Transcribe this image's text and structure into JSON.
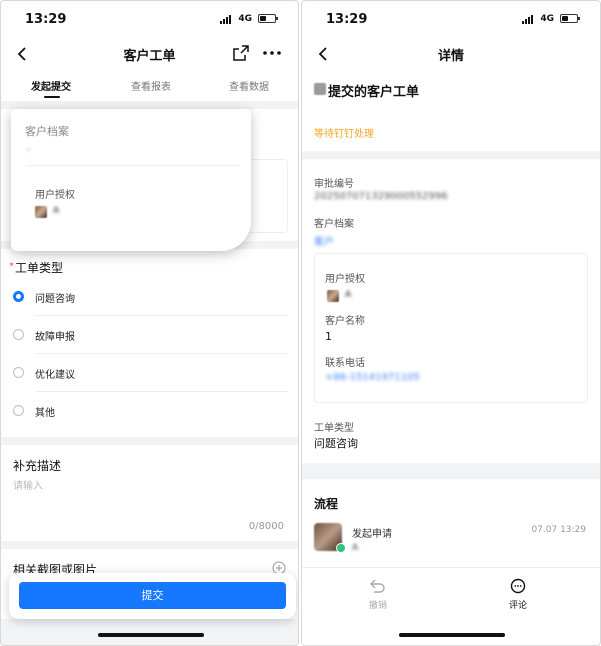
{
  "left": {
    "status": {
      "time": "13:29",
      "network": "4G"
    },
    "nav": {
      "title": "客户工单"
    },
    "tabs": [
      {
        "label": "发起提交"
      },
      {
        "label": "查看报表"
      },
      {
        "label": "查看数据"
      }
    ],
    "customer": {
      "label": "客户档案",
      "value": "·",
      "auth_label": "用户授权",
      "auth_user": "A"
    },
    "ticket_type": {
      "required_mark": "*",
      "label": "工单类型",
      "options": [
        {
          "label": "问题咨询",
          "selected": true
        },
        {
          "label": "故障申报",
          "selected": false
        },
        {
          "label": "优化建议",
          "selected": false
        },
        {
          "label": "其他",
          "selected": false
        }
      ]
    },
    "description": {
      "label": "补充描述",
      "placeholder": "请输入",
      "counter": "0/8000"
    },
    "attachments": {
      "label": "相关截图或图片"
    },
    "submit_label": "提交"
  },
  "right": {
    "status": {
      "time": "13:29",
      "network": "4G"
    },
    "nav": {
      "title": "详情"
    },
    "header": {
      "title": "提交的客户工单",
      "status": "等待钉钉处理"
    },
    "fields": {
      "approval_no_label": "审批编号",
      "approval_no": "202507071329000552996",
      "customer_label": "客户档案",
      "customer_value": "客户",
      "auth_label": "用户授权",
      "auth_user": "A",
      "name_label": "客户名称",
      "name_value": "1",
      "phone_label": "联系电话",
      "phone_value": "+86-15141971105",
      "type_label": "工单类型",
      "type_value": "问题咨询"
    },
    "process": {
      "label": "流程",
      "step": "发起申请",
      "user": "A",
      "time": "07.07 13:29"
    },
    "bottom": {
      "revoke": "撤销",
      "comment": "评论"
    }
  },
  "colors": {
    "accent": "#1677ff",
    "pending": "#f5a623",
    "required": "#ff4d4f"
  }
}
